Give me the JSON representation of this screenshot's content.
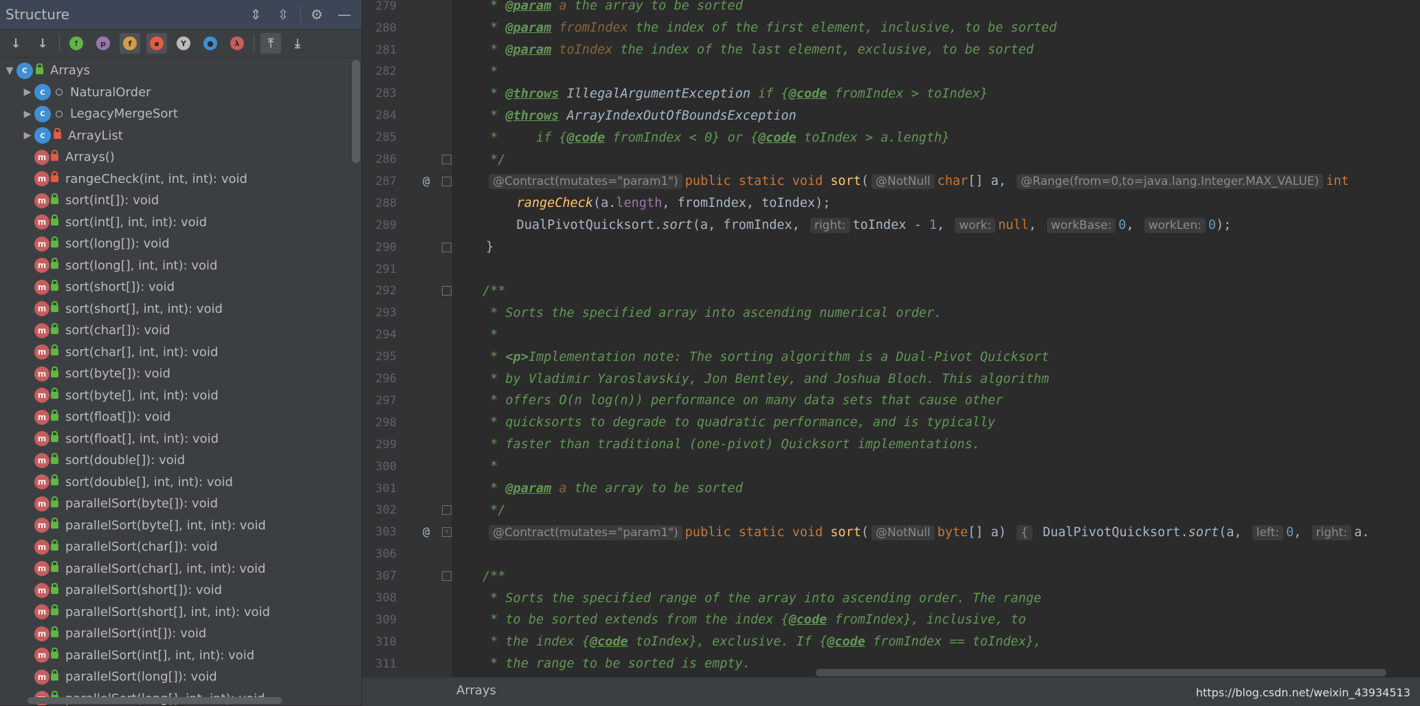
{
  "structure_panel": {
    "title": "Structure",
    "header_icons": [
      "expand-all-icon",
      "collapse-all-icon",
      "gear-icon",
      "minimize-icon"
    ],
    "toolbar_icons": [
      {
        "name": "sort-by-visibility-icon",
        "glyph": "↓",
        "active": false
      },
      {
        "name": "sort-alphabetically-icon",
        "glyph": "↓",
        "active": false
      },
      {
        "name": "show-inherited-icon",
        "glyph": "↑",
        "color": "#62b543",
        "active": false
      },
      {
        "name": "show-properties-icon",
        "glyph": "p",
        "color": "#9876aa",
        "active": false
      },
      {
        "name": "show-fields-icon",
        "glyph": "f",
        "color": "#d39b4a",
        "active": true
      },
      {
        "name": "show-non-public-icon",
        "glyph": "▪",
        "color": "#e25b45",
        "active": true
      },
      {
        "name": "show-lambdas-icon",
        "glyph": "Y",
        "color": "#bbbbbb",
        "active": false
      },
      {
        "name": "show-anonymous-icon",
        "glyph": "●",
        "color": "#3f8fd6",
        "active": false
      },
      {
        "name": "lambda-icon",
        "glyph": "λ",
        "color": "#c75d5d",
        "active": false
      },
      {
        "name": "autoscroll-to-source-icon",
        "glyph": "⤒",
        "active": true
      },
      {
        "name": "autoscroll-from-source-icon",
        "glyph": "⤓",
        "active": false
      }
    ],
    "tree": [
      {
        "label": "Arrays",
        "kind": "class",
        "vis": "public",
        "expander": "▼",
        "indent": 0
      },
      {
        "label": "NaturalOrder",
        "kind": "class",
        "vis": "package",
        "expander": "▶",
        "indent": 1
      },
      {
        "label": "LegacyMergeSort",
        "kind": "class",
        "vis": "package",
        "expander": "▶",
        "indent": 1
      },
      {
        "label": "ArrayList",
        "kind": "class",
        "vis": "private",
        "expander": "▶",
        "indent": 1
      },
      {
        "label": "Arrays()",
        "kind": "method",
        "vis": "private",
        "indent": 1
      },
      {
        "label": "rangeCheck(int, int, int): void",
        "kind": "method",
        "vis": "private",
        "indent": 1
      },
      {
        "label": "sort(int[]): void",
        "kind": "method",
        "vis": "public",
        "indent": 1
      },
      {
        "label": "sort(int[], int, int): void",
        "kind": "method",
        "vis": "public",
        "indent": 1
      },
      {
        "label": "sort(long[]): void",
        "kind": "method",
        "vis": "public",
        "indent": 1
      },
      {
        "label": "sort(long[], int, int): void",
        "kind": "method",
        "vis": "public",
        "indent": 1
      },
      {
        "label": "sort(short[]): void",
        "kind": "method",
        "vis": "public",
        "indent": 1
      },
      {
        "label": "sort(short[], int, int): void",
        "kind": "method",
        "vis": "public",
        "indent": 1
      },
      {
        "label": "sort(char[]): void",
        "kind": "method",
        "vis": "public",
        "indent": 1
      },
      {
        "label": "sort(char[], int, int): void",
        "kind": "method",
        "vis": "public",
        "indent": 1
      },
      {
        "label": "sort(byte[]): void",
        "kind": "method",
        "vis": "public",
        "indent": 1
      },
      {
        "label": "sort(byte[], int, int): void",
        "kind": "method",
        "vis": "public",
        "indent": 1
      },
      {
        "label": "sort(float[]): void",
        "kind": "method",
        "vis": "public",
        "indent": 1
      },
      {
        "label": "sort(float[], int, int): void",
        "kind": "method",
        "vis": "public",
        "indent": 1
      },
      {
        "label": "sort(double[]): void",
        "kind": "method",
        "vis": "public",
        "indent": 1
      },
      {
        "label": "sort(double[], int, int): void",
        "kind": "method",
        "vis": "public",
        "indent": 1
      },
      {
        "label": "parallelSort(byte[]): void",
        "kind": "method",
        "vis": "public",
        "indent": 1
      },
      {
        "label": "parallelSort(byte[], int, int): void",
        "kind": "method",
        "vis": "public",
        "indent": 1
      },
      {
        "label": "parallelSort(char[]): void",
        "kind": "method",
        "vis": "public",
        "indent": 1
      },
      {
        "label": "parallelSort(char[], int, int): void",
        "kind": "method",
        "vis": "public",
        "indent": 1
      },
      {
        "label": "parallelSort(short[]): void",
        "kind": "method",
        "vis": "public",
        "indent": 1
      },
      {
        "label": "parallelSort(short[], int, int): void",
        "kind": "method",
        "vis": "public",
        "indent": 1
      },
      {
        "label": "parallelSort(int[]): void",
        "kind": "method",
        "vis": "public",
        "indent": 1
      },
      {
        "label": "parallelSort(int[], int, int): void",
        "kind": "method",
        "vis": "public",
        "indent": 1
      },
      {
        "label": "parallelSort(long[]): void",
        "kind": "method",
        "vis": "public",
        "indent": 1
      },
      {
        "label": "parallelSort(long[], int, int): void",
        "kind": "method",
        "vis": "public",
        "indent": 1
      }
    ]
  },
  "editor": {
    "lines": [
      {
        "n": "279",
        "segs": [
          [
            "cm",
            " * "
          ],
          [
            "tag",
            "@param"
          ],
          [
            "pname",
            " a"
          ],
          [
            "cm",
            " the array to be sorted"
          ]
        ]
      },
      {
        "n": "280",
        "segs": [
          [
            "cm",
            " * "
          ],
          [
            "tag",
            "@param"
          ],
          [
            "pname",
            " fromIndex"
          ],
          [
            "cm",
            " the index of the first element, inclusive, to be sorted"
          ]
        ]
      },
      {
        "n": "281",
        "segs": [
          [
            "cm",
            " * "
          ],
          [
            "tag",
            "@param"
          ],
          [
            "pname",
            " toIndex"
          ],
          [
            "cm",
            " the index of the last element, exclusive, to be sorted"
          ]
        ]
      },
      {
        "n": "282",
        "segs": [
          [
            "cm",
            " *"
          ]
        ]
      },
      {
        "n": "283",
        "segs": [
          [
            "cm",
            " * "
          ],
          [
            "tag",
            "@throws"
          ],
          [
            "cm",
            " "
          ],
          [
            "plainital",
            "IllegalArgumentException"
          ],
          [
            "cm",
            " if {"
          ],
          [
            "tag",
            "@code"
          ],
          [
            "cm",
            " fromIndex > toIndex}"
          ]
        ]
      },
      {
        "n": "284",
        "segs": [
          [
            "cm",
            " * "
          ],
          [
            "tag",
            "@throws"
          ],
          [
            "cm",
            " "
          ],
          [
            "plainital",
            "ArrayIndexOutOfBoundsException"
          ]
        ]
      },
      {
        "n": "285",
        "segs": [
          [
            "cm",
            " *     if {"
          ],
          [
            "tag",
            "@code"
          ],
          [
            "cm",
            " fromIndex < 0} or {"
          ],
          [
            "tag",
            "@code"
          ],
          [
            "cm",
            " toIndex > a.length}"
          ]
        ]
      },
      {
        "n": "286",
        "segs": [
          [
            "cm",
            " */"
          ]
        ],
        "fold": "⌂"
      },
      {
        "n": "287",
        "at": true,
        "fold": "▿",
        "segs": [
          [
            "hint",
            "@Contract(mutates=\"param1\")"
          ],
          [
            "kw",
            "public static void "
          ],
          [
            "fn",
            "sort"
          ],
          [
            "plain",
            "("
          ],
          [
            "hint",
            "@NotNull"
          ],
          [
            "kw",
            "char"
          ],
          [
            "plain",
            "[] a, "
          ],
          [
            "hint",
            "@Range(from=0,to=java.lang.Integer.MAX_VALUE)"
          ],
          [
            "kw",
            "int"
          ]
        ]
      },
      {
        "n": "288",
        "segs": [
          [
            "plain",
            "    "
          ],
          [
            "fnit",
            "rangeCheck"
          ],
          [
            "plain",
            "(a."
          ],
          [
            "field",
            "length"
          ],
          [
            "plain",
            ", fromIndex, toIndex);"
          ]
        ]
      },
      {
        "n": "289",
        "segs": [
          [
            "plain",
            "    DualPivotQuicksort."
          ],
          [
            "ital",
            "sort"
          ],
          [
            "plain",
            "(a, fromIndex, "
          ],
          [
            "hint",
            "right:"
          ],
          [
            "plain",
            "toIndex - "
          ],
          [
            "num",
            "1"
          ],
          [
            "plain",
            ", "
          ],
          [
            "hint",
            "work:"
          ],
          [
            "kw",
            "null"
          ],
          [
            "plain",
            ", "
          ],
          [
            "hint",
            "workBase:"
          ],
          [
            "num",
            "0"
          ],
          [
            "plain",
            ", "
          ],
          [
            "hint",
            "workLen:"
          ],
          [
            "num",
            "0"
          ],
          [
            "plain",
            ");"
          ]
        ]
      },
      {
        "n": "290",
        "segs": [
          [
            "plain",
            "}"
          ]
        ],
        "fold": "⌂"
      },
      {
        "n": "291",
        "segs": []
      },
      {
        "n": "292",
        "fold": "▿",
        "segs": [
          [
            "cm",
            "/**"
          ]
        ]
      },
      {
        "n": "293",
        "segs": [
          [
            "cm",
            " * Sorts the specified array into ascending numerical order."
          ]
        ]
      },
      {
        "n": "294",
        "segs": [
          [
            "cm",
            " *"
          ]
        ]
      },
      {
        "n": "295",
        "segs": [
          [
            "cm",
            " * "
          ],
          [
            "tagplain",
            "<p>"
          ],
          [
            "cm",
            "Implementation note: The sorting algorithm is a Dual-Pivot Quicksort"
          ]
        ]
      },
      {
        "n": "296",
        "segs": [
          [
            "cm",
            " * by Vladimir Yaroslavskiy, Jon Bentley, and Joshua Bloch. This algorithm"
          ]
        ]
      },
      {
        "n": "297",
        "segs": [
          [
            "cm",
            " * offers O(n log(n)) performance on many data sets that cause other"
          ]
        ]
      },
      {
        "n": "298",
        "segs": [
          [
            "cm",
            " * quicksorts to degrade to quadratic performance, and is typically"
          ]
        ]
      },
      {
        "n": "299",
        "segs": [
          [
            "cm",
            " * faster than traditional (one-pivot) Quicksort implementations."
          ]
        ]
      },
      {
        "n": "300",
        "segs": [
          [
            "cm",
            " *"
          ]
        ]
      },
      {
        "n": "301",
        "segs": [
          [
            "cm",
            " * "
          ],
          [
            "tag",
            "@param"
          ],
          [
            "pname",
            " a"
          ],
          [
            "cm",
            " the array to be sorted"
          ]
        ]
      },
      {
        "n": "302",
        "segs": [
          [
            "cm",
            " */"
          ]
        ],
        "fold": "⌂"
      },
      {
        "n": "303",
        "at": true,
        "fold": "+",
        "segs": [
          [
            "hint",
            "@Contract(mutates=\"param1\")"
          ],
          [
            "kw",
            "public static void "
          ],
          [
            "fn",
            "sort"
          ],
          [
            "plain",
            "("
          ],
          [
            "hint",
            "@NotNull"
          ],
          [
            "kw",
            "byte"
          ],
          [
            "plain",
            "[] a) "
          ],
          [
            "brace",
            "{"
          ],
          [
            "plain",
            " DualPivotQuicksort."
          ],
          [
            "ital",
            "sort"
          ],
          [
            "plain",
            "(a, "
          ],
          [
            "hint",
            "left:"
          ],
          [
            "num",
            "0"
          ],
          [
            "plain",
            ", "
          ],
          [
            "hint",
            "right:"
          ],
          [
            "plain",
            "a."
          ]
        ]
      },
      {
        "n": "306",
        "segs": []
      },
      {
        "n": "307",
        "fold": "▿",
        "segs": [
          [
            "cm",
            "/**"
          ]
        ]
      },
      {
        "n": "308",
        "segs": [
          [
            "cm",
            " * Sorts the specified range of the array into ascending order. The range"
          ]
        ]
      },
      {
        "n": "309",
        "segs": [
          [
            "cm",
            " * to be sorted extends from the index {"
          ],
          [
            "tag",
            "@code"
          ],
          [
            "cm",
            " fromIndex}, inclusive, to"
          ]
        ]
      },
      {
        "n": "310",
        "segs": [
          [
            "cm",
            " * the index {"
          ],
          [
            "tag",
            "@code"
          ],
          [
            "cm",
            " toIndex}, exclusive. If {"
          ],
          [
            "tag",
            "@code"
          ],
          [
            "cm",
            " fromIndex == toIndex},"
          ]
        ]
      },
      {
        "n": "311",
        "segs": [
          [
            "cm",
            " * the range to be sorted is empty."
          ]
        ]
      }
    ],
    "line_indents": {
      "comment": 1,
      "code": 1
    }
  },
  "status_bar": {
    "breadcrumb": "Arrays",
    "watermark": "https://blog.csdn.net/weixin_43934513"
  }
}
